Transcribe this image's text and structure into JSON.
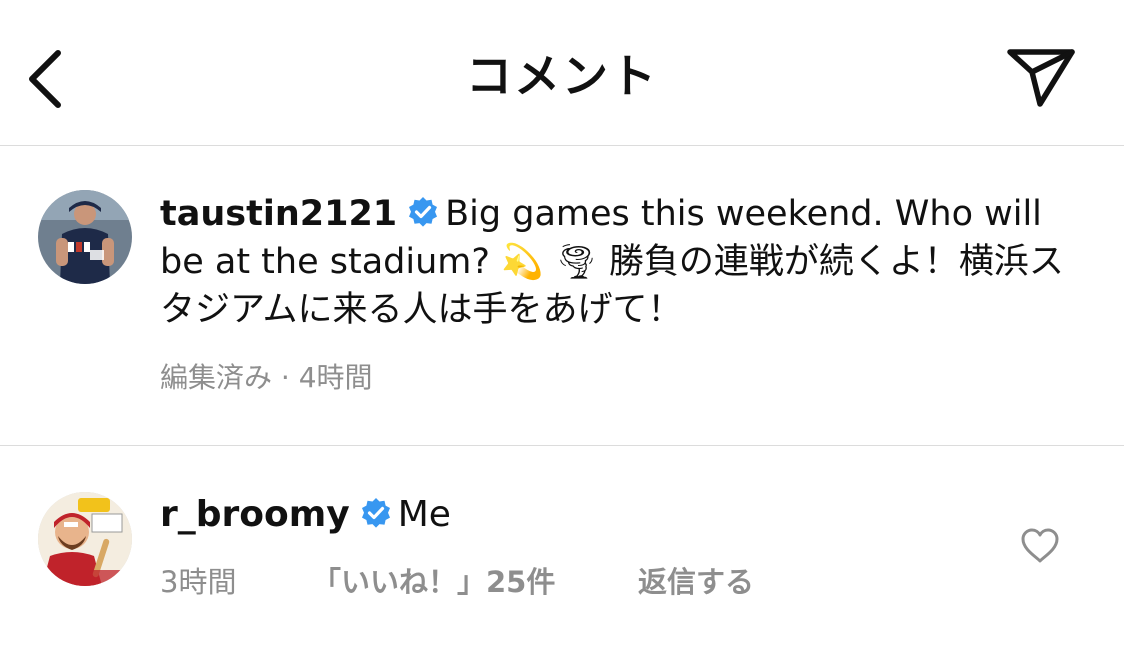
{
  "header": {
    "title": "コメント",
    "back_icon": "chevron-left-icon",
    "share_icon": "paper-plane-icon"
  },
  "post": {
    "username": "taustin2121",
    "verified": true,
    "text_en": "Big games this weekend. Who will be at the stadium?",
    "emoji_1": "💫",
    "emoji_2": "🌪",
    "text_jp": "勝負の連戦が続くよ！横浜スタジアムに来る人は手をあげて！",
    "edited_label": "編集済み",
    "separator": "·",
    "time": "4時間"
  },
  "comment": {
    "username": "r_broomy",
    "verified": true,
    "text": "Me",
    "time": "3時間",
    "likes": "「いいね！」25件",
    "reply": "返信する",
    "like_icon": "heart-outline-icon"
  },
  "colors": {
    "verified_blue": "#3897f0",
    "secondary_text": "#8e8e8e",
    "divider": "#dcdcdc"
  }
}
